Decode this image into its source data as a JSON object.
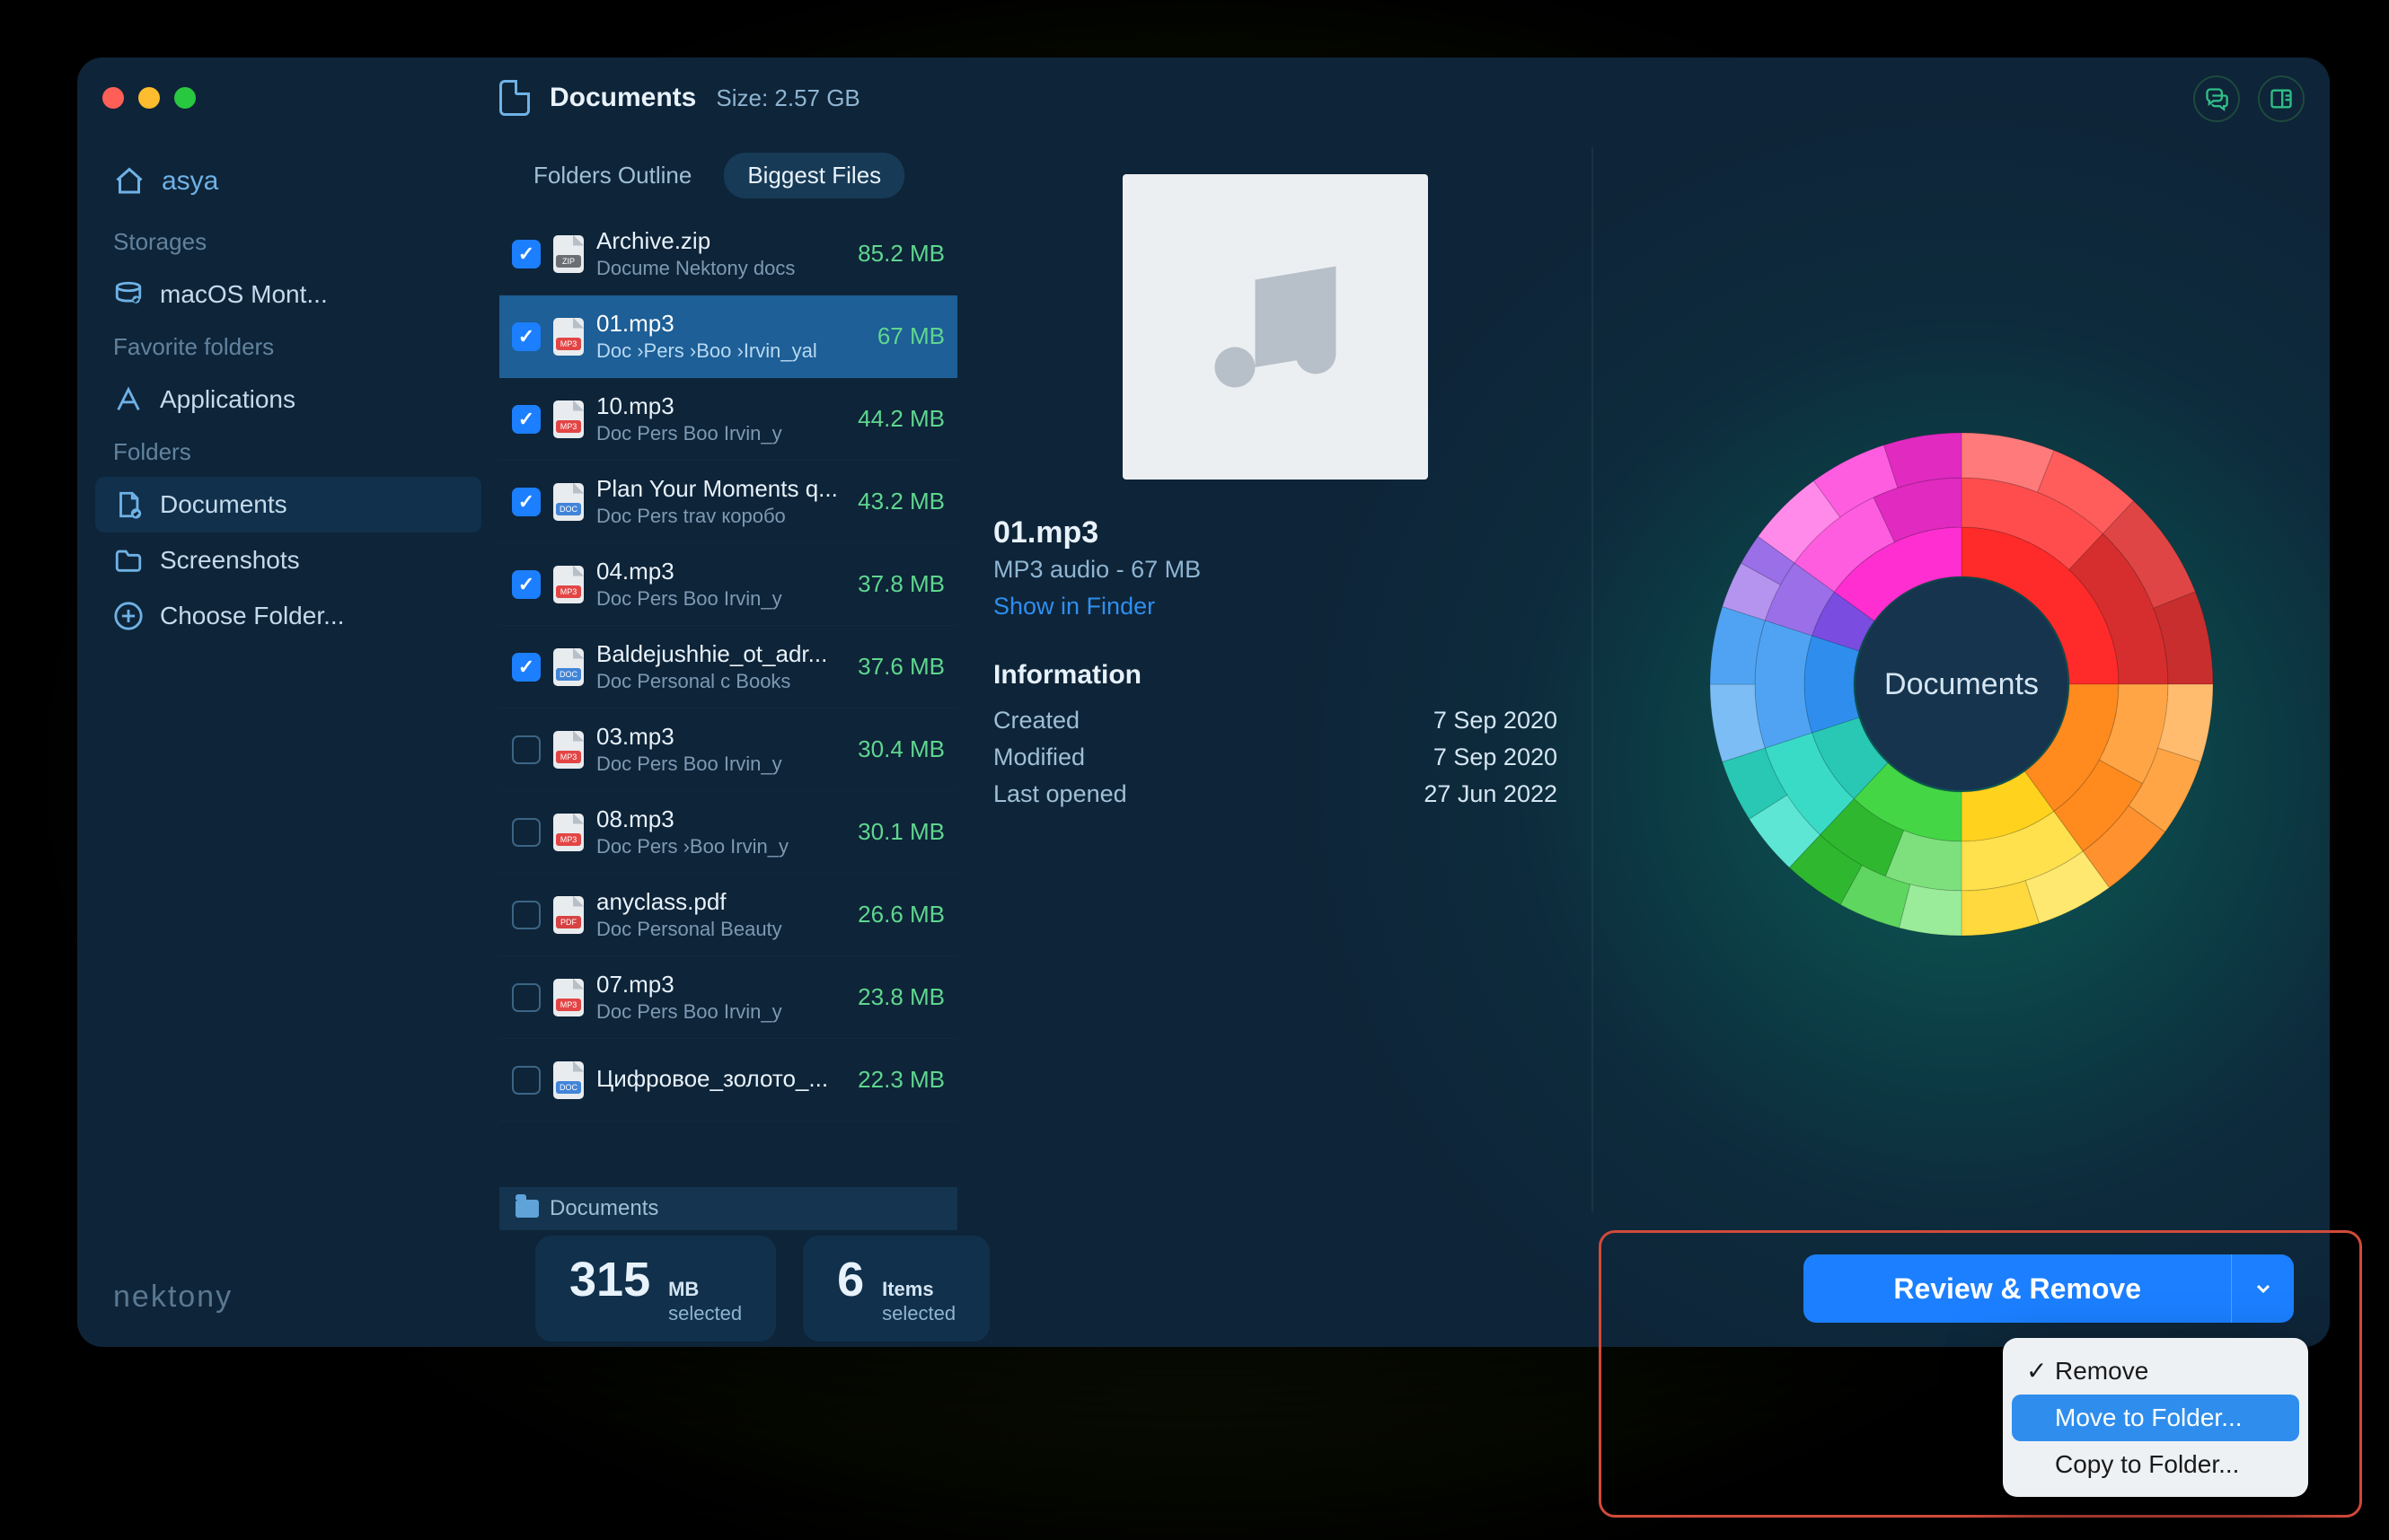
{
  "header": {
    "title": "Documents",
    "size_label": "Size: 2.57 GB"
  },
  "sidebar": {
    "user": "asya",
    "sections": {
      "storages": {
        "heading": "Storages",
        "items": [
          "macOS Mont..."
        ]
      },
      "favorites": {
        "heading": "Favorite folders",
        "items": [
          "Applications"
        ]
      },
      "folders": {
        "heading": "Folders",
        "items": [
          "Documents",
          "Screenshots",
          "Choose Folder..."
        ]
      }
    }
  },
  "tabs": {
    "outline": "Folders Outline",
    "biggest": "Biggest Files"
  },
  "files": [
    {
      "name": "Archive.zip",
      "path": "Docume  Nektony docs",
      "size": "85.2 MB",
      "type": "zip",
      "checked": true,
      "selected": false
    },
    {
      "name": "01.mp3",
      "path": "Doc ›Pers ›Boo ›Irvin_yal",
      "size": "67 MB",
      "type": "mp3",
      "checked": true,
      "selected": true
    },
    {
      "name": "10.mp3",
      "path": "Doc  Pers  Boo  Irvin_y",
      "size": "44.2 MB",
      "type": "mp3",
      "checked": true,
      "selected": false
    },
    {
      "name": "Plan Your Moments q...",
      "path": "Doc  Pers  trav  коробо",
      "size": "43.2 MB",
      "type": "doc",
      "checked": true,
      "selected": false
    },
    {
      "name": "04.mp3",
      "path": "Doc  Pers  Boo  Irvin_y",
      "size": "37.8 MB",
      "type": "mp3",
      "checked": true,
      "selected": false
    },
    {
      "name": "Baldejushhie_ot_adr...",
      "path": "Doc  Personal c  Books",
      "size": "37.6 MB",
      "type": "doc",
      "checked": true,
      "selected": false
    },
    {
      "name": "03.mp3",
      "path": "Doc  Pers  Boo  Irvin_y",
      "size": "30.4 MB",
      "type": "mp3",
      "checked": false,
      "selected": false
    },
    {
      "name": "08.mp3",
      "path": "Doc  Pers ›Boo  Irvin_y",
      "size": "30.1 MB",
      "type": "mp3",
      "checked": false,
      "selected": false
    },
    {
      "name": "anyclass.pdf",
      "path": "Doc  Personal   Beauty",
      "size": "26.6 MB",
      "type": "pdf",
      "checked": false,
      "selected": false
    },
    {
      "name": "07.mp3",
      "path": "Doc  Pers  Boo  Irvin_y",
      "size": "23.8 MB",
      "type": "mp3",
      "checked": false,
      "selected": false
    },
    {
      "name": "Цифровое_золото_...",
      "path": "",
      "size": "22.3 MB",
      "type": "doc",
      "checked": false,
      "selected": false
    }
  ],
  "breadcrumb": "Documents",
  "detail": {
    "name": "01.mp3",
    "subtitle": "MP3 audio - 67 MB",
    "link": "Show in Finder",
    "info_heading": "Information",
    "created_label": "Created",
    "created_value": "7 Sep 2020",
    "modified_label": "Modified",
    "modified_value": "7 Sep 2020",
    "opened_label": "Last opened",
    "opened_value": "27 Jun 2022"
  },
  "chart_center": "Documents",
  "stats": {
    "selected_size": "315",
    "selected_size_unit": "MB",
    "selected_size_label": "selected",
    "selected_count": "6",
    "selected_count_unit": "Items",
    "selected_count_label": "selected"
  },
  "review_button": "Review & Remove",
  "menu": {
    "remove": "Remove",
    "move": "Move to Folder...",
    "copy": "Copy to Folder..."
  },
  "brand": "nektony",
  "colors": {
    "accent": "#1b7fff",
    "size": "#5fd68f"
  },
  "chart_data": {
    "type": "sunburst",
    "title": "Documents",
    "rings": [
      {
        "ring": 1,
        "segments": [
          {
            "label": "",
            "value": 25,
            "color": "#ff2a2a"
          },
          {
            "label": "",
            "value": 15,
            "color": "#ff8a1e"
          },
          {
            "label": "",
            "value": 10,
            "color": "#ffd21e"
          },
          {
            "label": "",
            "value": 12,
            "color": "#45d645"
          },
          {
            "label": "",
            "value": 8,
            "color": "#28c8b4"
          },
          {
            "label": "",
            "value": 10,
            "color": "#2f8eed"
          },
          {
            "label": "",
            "value": 5,
            "color": "#7a4de0"
          },
          {
            "label": "",
            "value": 15,
            "color": "#ff2ed1"
          }
        ]
      },
      {
        "ring": 2,
        "segments": [
          {
            "label": "",
            "value": 12,
            "color": "#ff4d4d"
          },
          {
            "label": "",
            "value": 13,
            "color": "#d62e2e"
          },
          {
            "label": "",
            "value": 8,
            "color": "#ffa545"
          },
          {
            "label": "",
            "value": 7,
            "color": "#ff8a1e"
          },
          {
            "label": "",
            "value": 10,
            "color": "#ffe14d"
          },
          {
            "label": "",
            "value": 6,
            "color": "#7de07d"
          },
          {
            "label": "",
            "value": 6,
            "color": "#2fb82f"
          },
          {
            "label": "",
            "value": 8,
            "color": "#3adbc6"
          },
          {
            "label": "",
            "value": 10,
            "color": "#4fa3f2"
          },
          {
            "label": "",
            "value": 5,
            "color": "#9b6fe8"
          },
          {
            "label": "",
            "value": 8,
            "color": "#ff5de0"
          },
          {
            "label": "",
            "value": 7,
            "color": "#e02ac0"
          }
        ]
      },
      {
        "ring": 3,
        "segments": [
          {
            "label": "",
            "value": 6,
            "color": "#ff7a7a"
          },
          {
            "label": "",
            "value": 6,
            "color": "#ff5c5c"
          },
          {
            "label": "",
            "value": 7,
            "color": "#e04545"
          },
          {
            "label": "",
            "value": 6,
            "color": "#c92e2e"
          },
          {
            "label": "",
            "value": 5,
            "color": "#ffbb6e"
          },
          {
            "label": "",
            "value": 5,
            "color": "#ffa545"
          },
          {
            "label": "",
            "value": 5,
            "color": "#ff912e"
          },
          {
            "label": "",
            "value": 5,
            "color": "#ffe870"
          },
          {
            "label": "",
            "value": 5,
            "color": "#ffd93d"
          },
          {
            "label": "",
            "value": 4,
            "color": "#9aeb9a"
          },
          {
            "label": "",
            "value": 4,
            "color": "#5fd65f"
          },
          {
            "label": "",
            "value": 4,
            "color": "#2fb82f"
          },
          {
            "label": "",
            "value": 4,
            "color": "#5ee6d4"
          },
          {
            "label": "",
            "value": 4,
            "color": "#28c8b4"
          },
          {
            "label": "",
            "value": 5,
            "color": "#7cbdf5"
          },
          {
            "label": "",
            "value": 5,
            "color": "#4fa3f2"
          },
          {
            "label": "",
            "value": 3,
            "color": "#b594ef"
          },
          {
            "label": "",
            "value": 2,
            "color": "#9b6fe8"
          },
          {
            "label": "",
            "value": 5,
            "color": "#ff8aea"
          },
          {
            "label": "",
            "value": 5,
            "color": "#ff5de0"
          },
          {
            "label": "",
            "value": 5,
            "color": "#e02ac0"
          }
        ]
      }
    ]
  }
}
